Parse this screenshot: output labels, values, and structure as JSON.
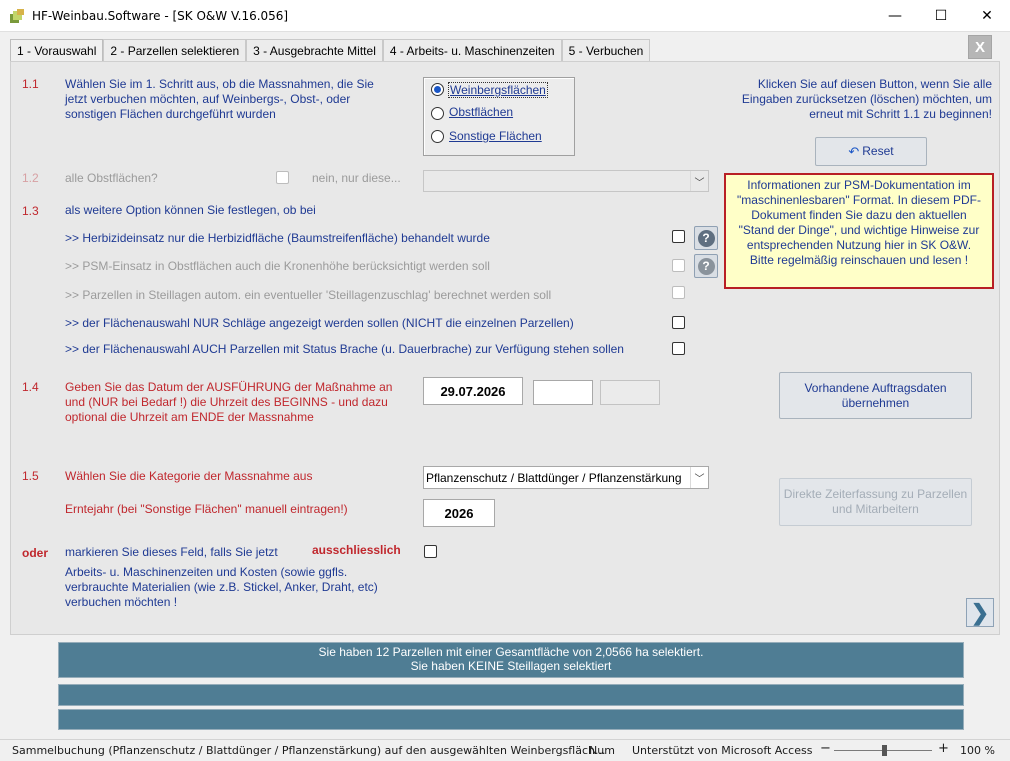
{
  "window": {
    "title": "HF-Weinbau.Software - [SK O&W V.16.056]",
    "minimize": "—",
    "maximize": "☐",
    "close": "✕"
  },
  "tabs": [
    {
      "label": "1 - Vorauswahl",
      "active": true
    },
    {
      "label": "2 - Parzellen selektieren"
    },
    {
      "label": "3 - Ausgebrachte Mittel"
    },
    {
      "label": "4 - Arbeits- u. Maschinenzeiten"
    },
    {
      "label": "5 - Verbuchen"
    }
  ],
  "close_form": "X",
  "s11": {
    "num": "1.1",
    "text": "Wählen Sie im 1. Schritt aus, ob die Massnahmen, die Sie jetzt verbuchen möchten, auf Weinbergs-, Obst-, oder sonstigen Flächen durchgeführt wurden",
    "options": [
      "Weinbergsflächen",
      "Obstflächen",
      "Sonstige Flächen"
    ],
    "selected": "Weinbergsflächen"
  },
  "reset": {
    "hint": "Klicken Sie auf diesen Button, wenn Sie alle Eingaben zurücksetzen (löschen) möchten, um erneut mit Schritt 1.1 zu beginnen!",
    "label": "Reset"
  },
  "s12": {
    "num": "1.2",
    "label": "alle Obstflächen?",
    "label2": "nein, nur diese..."
  },
  "info_box": "Informationen zur PSM-Dokumentation im \"maschinenlesbaren\" Format. In diesem PDF-Dokument finden Sie dazu den aktuellen \"Stand der Dinge\", und wichtige Hinweise zur entsprechenden Nutzung hier in SK O&W. Bitte regelmäßig reinschauen und lesen !",
  "s13": {
    "num": "1.3",
    "intro": "als weitere Option können Sie festlegen, ob bei",
    "options": [
      ">> Herbizideinsatz nur die Herbizidfläche (Baumstreifenfläche) behandelt wurde",
      ">> PSM-Einsatz in Obstflächen auch die Kronenhöhe berücksichtigt werden soll",
      ">> Parzellen in Steillagen autom. ein eventueller 'Steillagenzuschlag' berechnet werden soll",
      ">> der Flächenauswahl NUR Schläge angezeigt werden sollen (NICHT die einzelnen Parzellen)",
      ">> der Flächenauswahl AUCH Parzellen mit Status Brache (u. Dauerbrache) zur Verfügung stehen sollen"
    ],
    "help": "?"
  },
  "s14": {
    "num": "1.4",
    "text": "Geben Sie das Datum der AUSFÜHRUNG der Maßnahme an und (NUR bei Bedarf !) die Uhrzeit des BEGINNS - und dazu optional die Uhrzeit am ENDE der Massnahme",
    "date": "29.07.2026",
    "start_time": "",
    "end_time": "",
    "button": "Vorhandene Auftragsdaten übernehmen"
  },
  "s15": {
    "num": "1.5",
    "text": "Wählen Sie die Kategorie der Massnahme aus",
    "category": "Pflanzenschutz / Blattdünger / Pflanzenstärkung",
    "harvest_label": "Erntejahr (bei \"Sonstige Flächen\" manuell eintragen!)",
    "harvest_year": "2026",
    "button": "Direkte Zeiterfassung zu Parzellen und Mitarbeitern"
  },
  "oder": {
    "num": "oder",
    "text1": "markieren Sie dieses Feld, falls Sie jetzt",
    "emph": "ausschliesslich",
    "text2": "Arbeits- u. Maschinenzeiten und Kosten (sowie ggfls. verbrauchte Materialien (wie z.B. Stickel, Anker, Draht, etc) verbuchen möchten !"
  },
  "summary": {
    "line1": "Sie haben 12 Parzellen mit einer Gesamtfläche von 2,0566 ha selektiert.",
    "line2": "Sie haben KEINE Steillagen selektiert"
  },
  "statusbar": {
    "text": "Sammelbuchung (Pflanzenschutz / Blattdünger / Pflanzenstärkung) auf den ausgewählten Weinbergsfläch...",
    "num": "Num",
    "access": "Unterstützt von Microsoft Access",
    "zoom": "100 %"
  }
}
